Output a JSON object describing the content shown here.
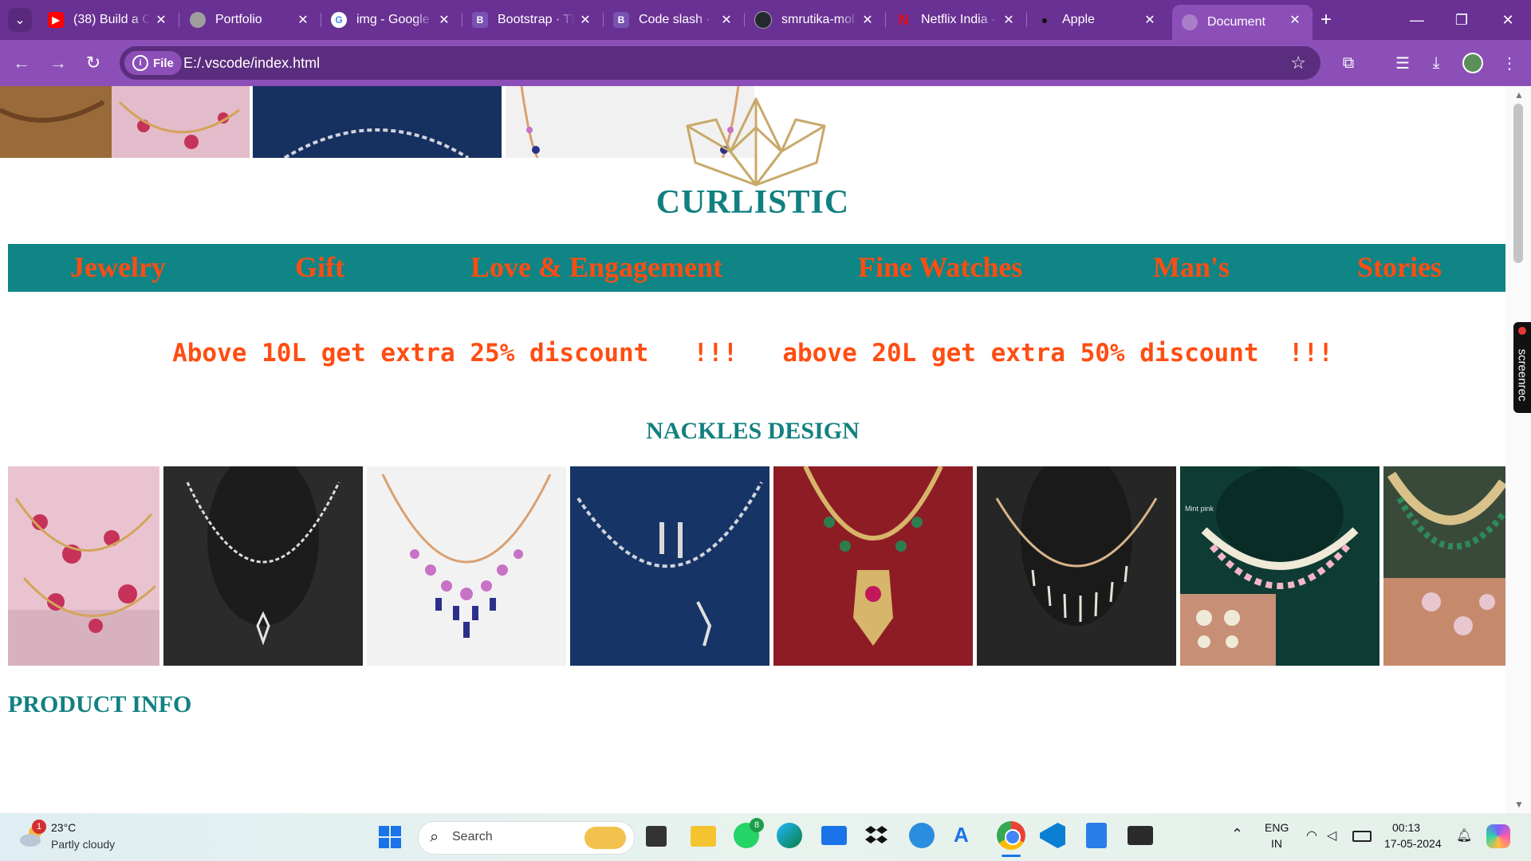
{
  "browser": {
    "tabs": [
      {
        "title": "(38) Build a C",
        "favicon": "youtube-icon",
        "color": "#ff0000"
      },
      {
        "title": "Portfolio",
        "favicon": "globe-icon",
        "color": "#9e9e9e"
      },
      {
        "title": "img - Google",
        "favicon": "google-icon",
        "color": "#ffffff"
      },
      {
        "title": "Bootstrap · Th",
        "favicon": "bootstrap-icon",
        "color": "#7952b3"
      },
      {
        "title": "Code slash · B",
        "favicon": "bootstrap-icon",
        "color": "#7952b3"
      },
      {
        "title": "smrutika-mol",
        "favicon": "github-icon",
        "color": "#24292f"
      },
      {
        "title": "Netflix India -",
        "favicon": "netflix-icon",
        "color": "#e50914"
      },
      {
        "title": "Apple",
        "favicon": "apple-icon",
        "color": "#111111"
      },
      {
        "title": "Document",
        "favicon": "globe-icon",
        "color": "#9e9e9e",
        "active": true
      }
    ],
    "address": {
      "scheme_chip": "File",
      "url": "E:/.vscode/index.html"
    }
  },
  "page": {
    "brand": "CURLISTIC",
    "nav": [
      "Jewelry",
      "Gift",
      "Love & Engagement",
      "Fine Watches",
      "Man's",
      "Stories"
    ],
    "promo": "Above 10L get extra 25% discount   !!!   above 20L get extra 50% discount  !!!",
    "section_necklaces": "NACKLES DESIGN",
    "section_product": "PRODUCT INFO",
    "gallery": [
      {
        "alt": "pink kundan necklace set",
        "theme": "pink"
      },
      {
        "alt": "silver pendant necklace on black bust",
        "theme": "black-silver"
      },
      {
        "alt": "pink and blue stone necklace",
        "theme": "white-pink"
      },
      {
        "alt": "diamond leaf necklace with earrings",
        "theme": "navy"
      },
      {
        "alt": "gold and green stone necklace",
        "theme": "red-gold"
      },
      {
        "alt": "diamond drop necklace on black bust",
        "theme": "black-gold"
      },
      {
        "alt": "kundan choker with mint pink stones",
        "theme": "green-kundan"
      },
      {
        "alt": "kundan necklace set in hand",
        "theme": "pink-green"
      }
    ],
    "gallery_watermark": "Mint pink"
  },
  "taskbar": {
    "weather": {
      "temp": "23°C",
      "condition": "Partly cloudy",
      "badge": "1"
    },
    "search_placeholder": "Search",
    "whatsapp_badge": "8",
    "lang": {
      "line1": "ENG",
      "line2": "IN"
    },
    "time": "00:13",
    "date": "17-05-2024"
  },
  "side_widget": "screenrec",
  "colors": {
    "teal": "#128080",
    "accent": "#ff4d12",
    "chrome": "#8c4fb8"
  }
}
